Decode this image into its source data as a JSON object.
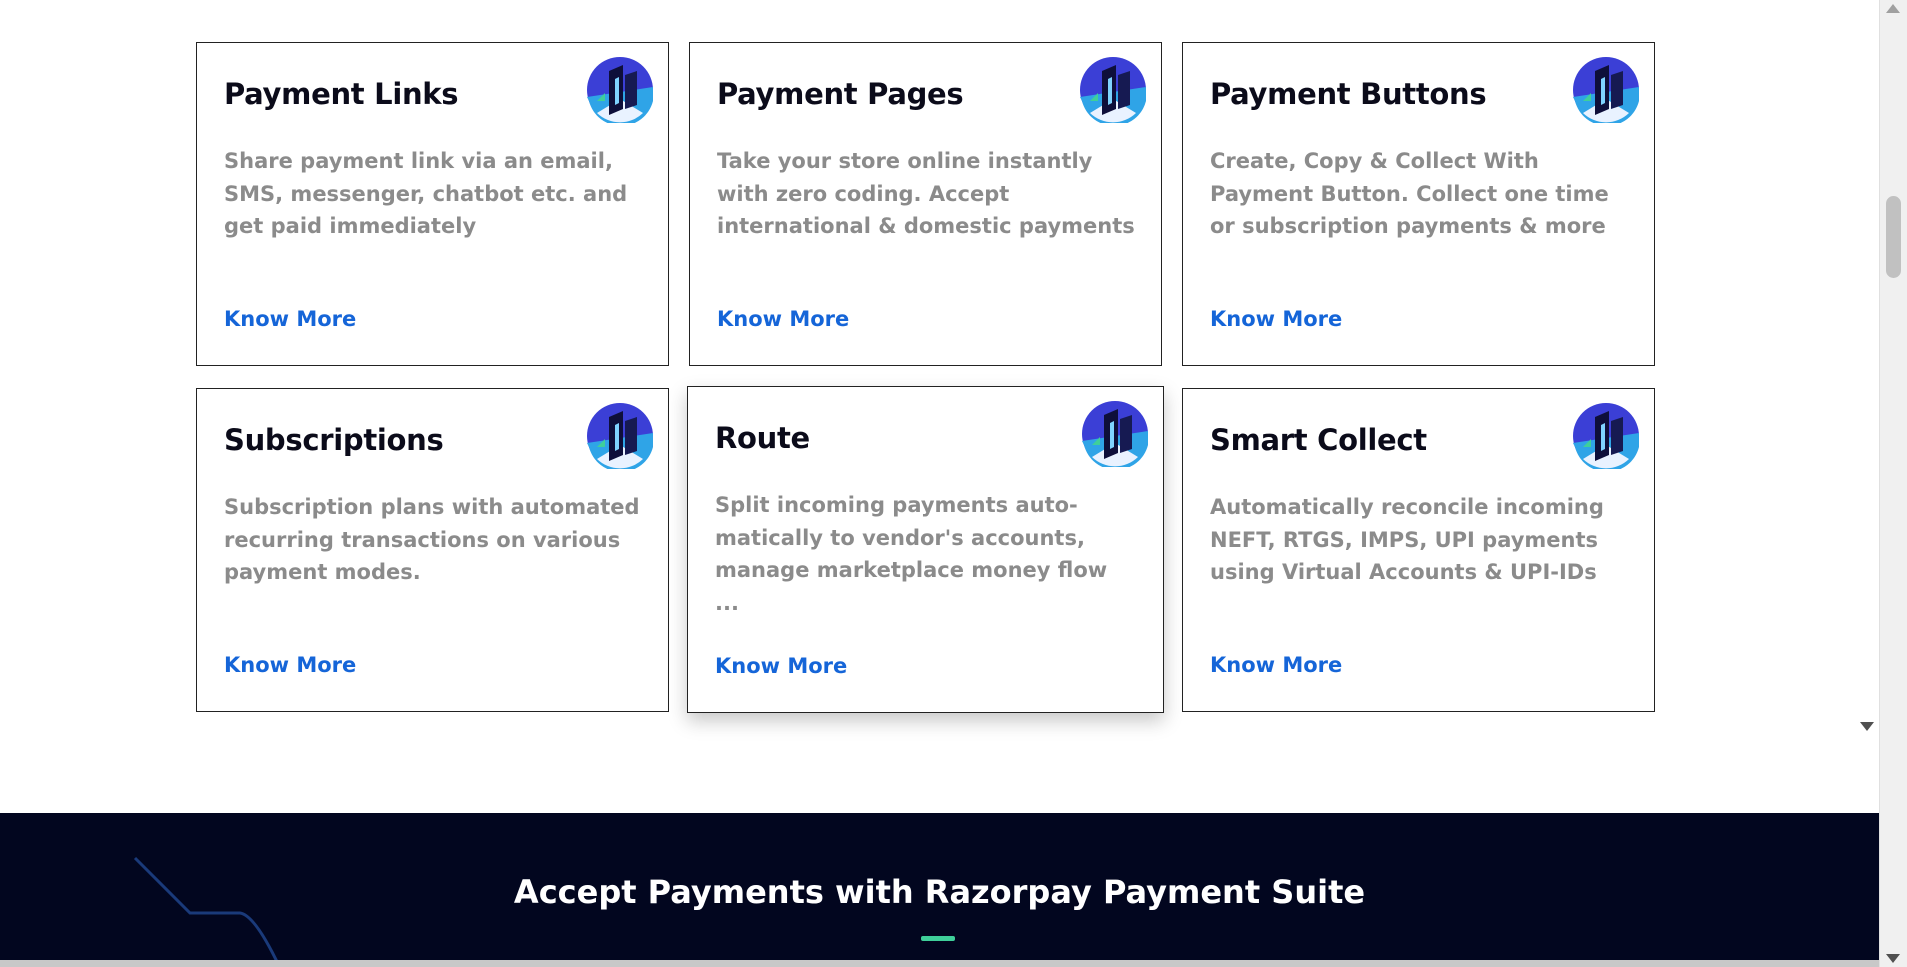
{
  "cards": [
    {
      "title": "Payment Links",
      "desc": "Share payment link via an email, SMS, messenger, chatbot etc. and get paid immediately",
      "link": "Know More"
    },
    {
      "title": "Payment Pages",
      "desc": "Take your store online instantly with zero coding. Accept international & domestic payments",
      "link": "Know More"
    },
    {
      "title": "Payment Buttons",
      "desc": "Create, Copy & Collect With Payment Button. Collect one time or subscription payments & more",
      "link": "Know More"
    },
    {
      "title": "Subscriptions",
      "desc": "Subscription plans with automated recurring transactions on various payment modes.",
      "link": "Know More"
    },
    {
      "title": "Route",
      "desc": "Split incoming payments auto-matically to vendor's accounts, manage marketplace money flow ...",
      "link": "Know More"
    },
    {
      "title": "Smart Collect",
      "desc": "Automatically reconcile incoming NEFT, RTGS, IMPS, UPI payments using Virtual Accounts & UPI-IDs",
      "link": "Know More"
    }
  ],
  "banner": {
    "title": "Accept Payments with Razorpay Payment Suite"
  },
  "icons": {
    "product_logo": "product-logo-icon"
  },
  "colors": {
    "link": "#1565d8",
    "banner_bg": "#02061f",
    "accent": "#3fcf9a"
  }
}
